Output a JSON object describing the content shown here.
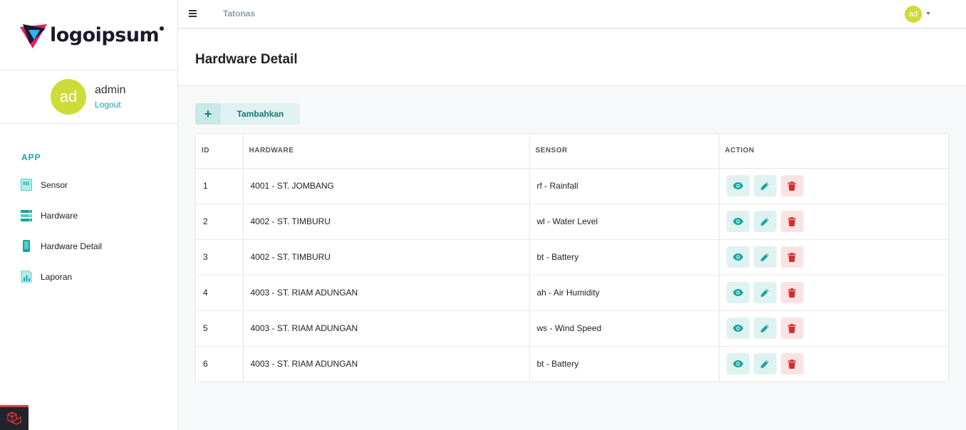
{
  "brand": {
    "logo_text": "logoipsum",
    "app_name": "Tatonas"
  },
  "user": {
    "initials": "ad",
    "name": "admin",
    "logout_label": "Logout"
  },
  "sidebar": {
    "section_title": "APP",
    "items": [
      {
        "label": "Sensor",
        "icon": "sensor-icon"
      },
      {
        "label": "Hardware",
        "icon": "server-icon"
      },
      {
        "label": "Hardware Detail",
        "icon": "device-icon"
      },
      {
        "label": "Laporan",
        "icon": "report-icon"
      }
    ]
  },
  "page": {
    "title": "Hardware Detail",
    "add_label": "Tambahkan",
    "add_icon": "plus-icon"
  },
  "table": {
    "columns": [
      "ID",
      "HARDWARE",
      "SENSOR",
      "ACTION"
    ],
    "rows": [
      {
        "id": "1",
        "hardware": "4001 - ST. JOMBANG",
        "sensor": "rf - Rainfall"
      },
      {
        "id": "2",
        "hardware": "4002 - ST. TIMBURU",
        "sensor": "wl - Water Level"
      },
      {
        "id": "3",
        "hardware": "4002 - ST. TIMBURU",
        "sensor": "bt - Battery"
      },
      {
        "id": "4",
        "hardware": "4003 - ST. RIAM ADUNGAN",
        "sensor": "ah - Air Humidity"
      },
      {
        "id": "5",
        "hardware": "4003 - ST. RIAM ADUNGAN",
        "sensor": "ws - Wind Speed"
      },
      {
        "id": "6",
        "hardware": "4003 - ST. RIAM ADUNGAN",
        "sensor": "bt - Battery"
      }
    ],
    "row_actions": [
      "eye-icon",
      "pencil-icon",
      "trash-icon"
    ]
  },
  "colors": {
    "accent": "#16a6a0",
    "avatar": "#cddc39",
    "danger": "#d32f2f",
    "view_bg": "#dff2f1",
    "delete_bg": "#fbe3e3"
  }
}
